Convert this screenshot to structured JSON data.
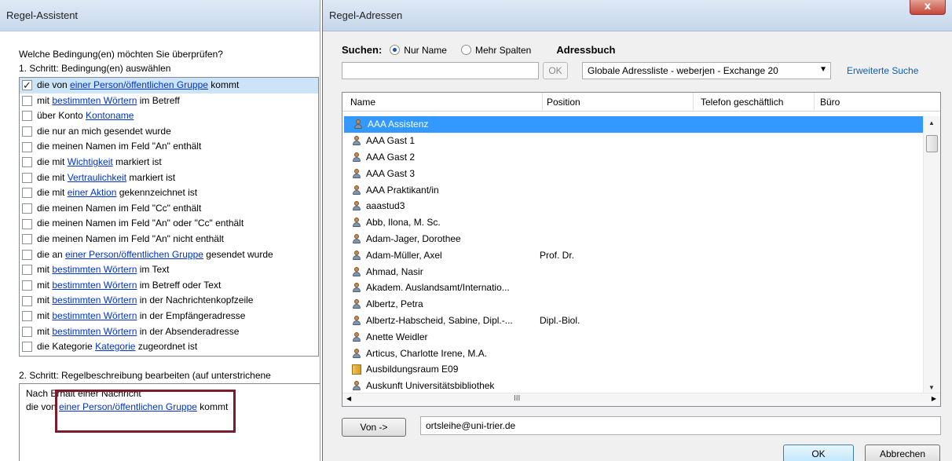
{
  "wizard": {
    "title": "Regel-Assistent",
    "question": "Welche Bedingung(en) möchten Sie überprüfen?",
    "step1": "1. Schritt: Bedingung(en) auswählen",
    "conditions": [
      {
        "checked": true,
        "pre": "die von ",
        "link": "einer Person/öffentlichen Gruppe",
        "post": " kommt"
      },
      {
        "checked": false,
        "pre": "mit ",
        "link": "bestimmten Wörtern",
        "post": " im Betreff"
      },
      {
        "checked": false,
        "pre": "über Konto ",
        "link": "Kontoname",
        "post": ""
      },
      {
        "checked": false,
        "pre": "die nur an mich gesendet wurde",
        "link": "",
        "post": ""
      },
      {
        "checked": false,
        "pre": "die meinen Namen im Feld \"An\" enthält",
        "link": "",
        "post": ""
      },
      {
        "checked": false,
        "pre": "die mit ",
        "link": "Wichtigkeit",
        "post": " markiert ist"
      },
      {
        "checked": false,
        "pre": "die mit ",
        "link": "Vertraulichkeit",
        "post": " markiert ist"
      },
      {
        "checked": false,
        "pre": "die mit ",
        "link": "einer Aktion",
        "post": " gekennzeichnet ist"
      },
      {
        "checked": false,
        "pre": "die meinen Namen im Feld \"Cc\" enthält",
        "link": "",
        "post": ""
      },
      {
        "checked": false,
        "pre": "die meinen Namen im Feld \"An\" oder \"Cc\" enthält",
        "link": "",
        "post": ""
      },
      {
        "checked": false,
        "pre": "die meinen Namen im Feld \"An\" nicht enthält",
        "link": "",
        "post": ""
      },
      {
        "checked": false,
        "pre": "die an ",
        "link": "einer Person/öffentlichen Gruppe",
        "post": " gesendet wurde"
      },
      {
        "checked": false,
        "pre": "mit ",
        "link": "bestimmten Wörtern",
        "post": " im Text"
      },
      {
        "checked": false,
        "pre": "mit ",
        "link": "bestimmten Wörtern",
        "post": " im Betreff oder Text"
      },
      {
        "checked": false,
        "pre": "mit ",
        "link": "bestimmten Wörtern",
        "post": " in der Nachrichtenkopfzeile"
      },
      {
        "checked": false,
        "pre": "mit ",
        "link": "bestimmten Wörtern",
        "post": " in der Empfängeradresse"
      },
      {
        "checked": false,
        "pre": "mit ",
        "link": "bestimmten Wörtern",
        "post": " in der Absenderadresse"
      },
      {
        "checked": false,
        "pre": "die Kategorie ",
        "link": "Kategorie",
        "post": " zugeordnet ist"
      }
    ],
    "step2": "2. Schritt: Regelbeschreibung bearbeiten (auf unterstrichene",
    "description": {
      "line1": "Nach Erhalt einer Nachricht",
      "line2_pre": "die von ",
      "line2_link": "einer Person/öffentlichen Gruppe",
      "line2_post": " kommt"
    },
    "highlight_color": "#7b1c2c"
  },
  "address_dialog": {
    "title": "Regel-Adressen",
    "close_label": "x",
    "search_label": "Suchen:",
    "radio_name_only": "Nur Name",
    "radio_more_columns": "Mehr Spalten",
    "addressbook_label": "Adressbuch",
    "search_value": "",
    "ok_small": "OK",
    "addressbook_value": "Globale Adressliste - weberjen - Exchange 20",
    "advanced_search": "Erweiterte Suche",
    "columns": [
      "Name",
      "Position",
      "Telefon geschäftlich",
      "Büro"
    ],
    "entries": [
      {
        "name": "AAA Assistenz",
        "position": "",
        "type": "person",
        "selected": true
      },
      {
        "name": "AAA Gast 1",
        "position": "",
        "type": "person"
      },
      {
        "name": "AAA Gast 2",
        "position": "",
        "type": "person"
      },
      {
        "name": "AAA Gast 3",
        "position": "",
        "type": "person"
      },
      {
        "name": "AAA Praktikant/in",
        "position": "",
        "type": "person"
      },
      {
        "name": "aaastud3",
        "position": "",
        "type": "person"
      },
      {
        "name": "Abb, Ilona, M. Sc.",
        "position": "",
        "type": "person"
      },
      {
        "name": "Adam-Jager, Dorothee",
        "position": "",
        "type": "person"
      },
      {
        "name": "Adam-Müller, Axel",
        "position": "Prof. Dr.",
        "type": "person"
      },
      {
        "name": "Ahmad, Nasir",
        "position": "",
        "type": "person"
      },
      {
        "name": "Akadem. Auslandsamt/Internatio...",
        "position": "",
        "type": "person"
      },
      {
        "name": "Albertz, Petra",
        "position": "",
        "type": "person"
      },
      {
        "name": "Albertz-Habscheid, Sabine, Dipl.-...",
        "position": "Dipl.-Biol.",
        "type": "person"
      },
      {
        "name": "Anette Weidler",
        "position": "",
        "type": "person"
      },
      {
        "name": "Articus, Charlotte Irene, M.A.",
        "position": "",
        "type": "person"
      },
      {
        "name": "Ausbildungsraum E09",
        "position": "",
        "type": "room"
      },
      {
        "name": "Auskunft Universitätsbibliothek",
        "position": "",
        "type": "person"
      }
    ],
    "hscroll_grip": "III",
    "from_button": "Von ->",
    "from_value": "ortsleihe@uni-trier.de",
    "ok_button": "OK",
    "cancel_button": "Abbrechen",
    "selection_color": "#3399ff"
  }
}
